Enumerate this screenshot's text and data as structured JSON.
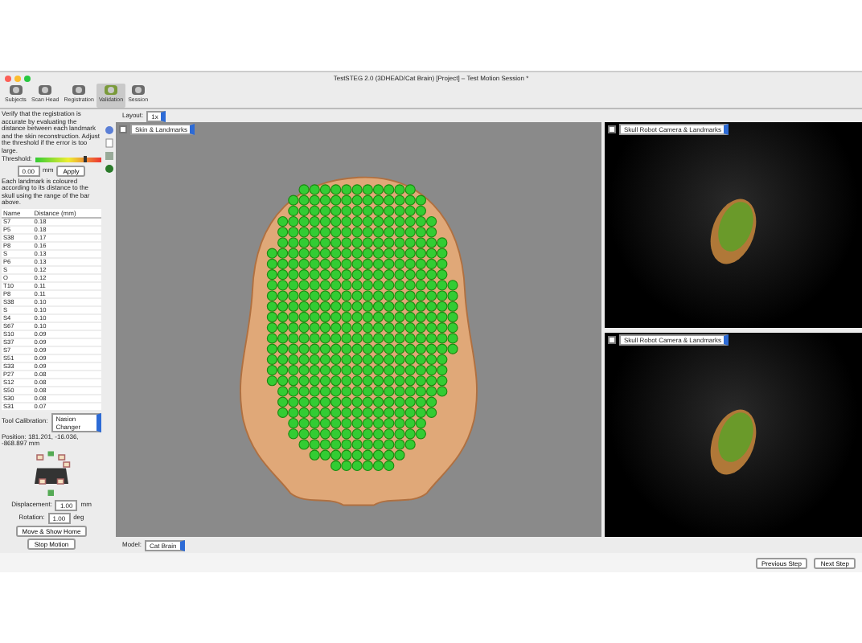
{
  "window": {
    "title": "TestSTEG 2.0 (3DHEAD/Cat Brain) [Project] – Test Motion Session *"
  },
  "toolbar": [
    {
      "label": "Subjects",
      "selected": false
    },
    {
      "label": "Scan Head",
      "selected": false
    },
    {
      "label": "Registration",
      "selected": false
    },
    {
      "label": "Validation",
      "selected": true
    },
    {
      "label": "Session",
      "selected": false
    }
  ],
  "left_panel": {
    "intro": "Verify that the registration is accurate by evaluating the distance between each landmark and the skin reconstruction. Adjust the threshold if the error is too large.",
    "threshold": {
      "label": "Threshold:",
      "level": 0.75,
      "value": "0.00",
      "unit": "mm",
      "button": "Apply"
    },
    "legend": "Each landmark is coloured according to its distance to the skull using the range of the bar above.",
    "table": {
      "columns": [
        "Name",
        "Distance (mm)"
      ],
      "rows": [
        [
          "S7",
          "0.18"
        ],
        [
          "P5",
          "0.18"
        ],
        [
          "S38",
          "0.17"
        ],
        [
          "P8",
          "0.16"
        ],
        [
          "S",
          "0.13"
        ],
        [
          "P6",
          "0.13"
        ],
        [
          "S",
          "0.12"
        ],
        [
          "O",
          "0.12"
        ],
        [
          "T10",
          "0.11"
        ],
        [
          "P8",
          "0.11"
        ],
        [
          "S38",
          "0.10"
        ],
        [
          "S",
          "0.10"
        ],
        [
          "S4",
          "0.10"
        ],
        [
          "S67",
          "0.10"
        ],
        [
          "S10",
          "0.09"
        ],
        [
          "S37",
          "0.09"
        ],
        [
          "S7",
          "0.09"
        ],
        [
          "S51",
          "0.09"
        ],
        [
          "S33",
          "0.09"
        ],
        [
          "P27",
          "0.08"
        ],
        [
          "S12",
          "0.08"
        ],
        [
          "S50",
          "0.08"
        ],
        [
          "S30",
          "0.08"
        ],
        [
          "S31",
          "0.07"
        ]
      ]
    },
    "calibration": {
      "label": "Tool Calibration:",
      "value": "Nasion Changer"
    },
    "position": "Position: 181.201, -16.036, -868.897 mm",
    "displacement": {
      "label": "Displacement:",
      "value": "1.00",
      "unit": "mm"
    },
    "rotation": {
      "label": "Rotation:",
      "value": "1.00",
      "unit": "deg"
    },
    "buttons": [
      "Move & Show Home",
      "Stop Motion"
    ]
  },
  "layout": {
    "label": "Layout:",
    "value": "1x"
  },
  "views": [
    {
      "kind": "main",
      "checked": false,
      "title": "Skin & Landmarks"
    },
    {
      "kind": "camera",
      "checked": false,
      "title": "Skull Robot Camera & Landmarks"
    },
    {
      "kind": "camera",
      "checked": false,
      "title": "Skull Robot Camera & Landmarks"
    }
  ],
  "model": {
    "label": "Model:",
    "value": "Cat Brain"
  },
  "footer_buttons": [
    "Previous Step",
    "Next Step"
  ]
}
